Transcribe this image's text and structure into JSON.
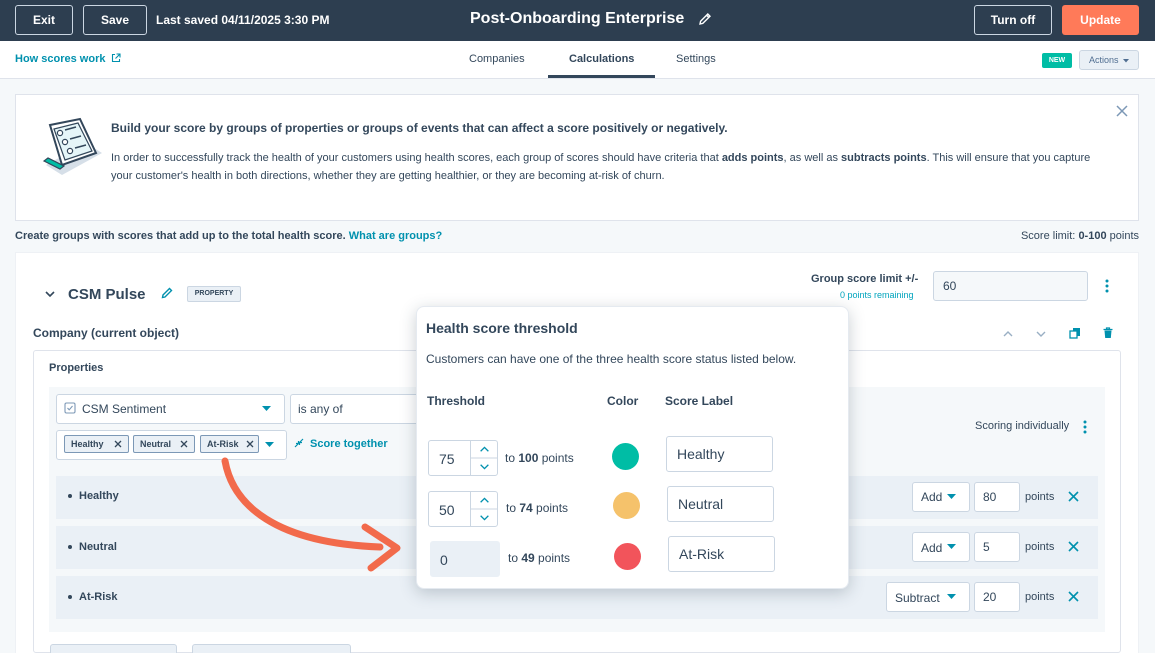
{
  "topbar": {
    "exit_label": "Exit",
    "save_label": "Save",
    "last_saved": "Last saved 04/11/2025 3:30 PM",
    "title": "Post-Onboarding Enterprise",
    "turn_off_label": "Turn off",
    "update_label": "Update"
  },
  "subnav": {
    "how_scores_work": "How scores work",
    "tabs": [
      {
        "label": "Companies"
      },
      {
        "label": "Calculations"
      },
      {
        "label": "Settings"
      }
    ],
    "new_badge": "NEW",
    "actions_label": "Actions"
  },
  "banner": {
    "title": "Build your score by groups of properties or groups of events that can affect a score positively or negatively.",
    "body_part1": "In order to successfully track the health of your customers using health scores, each group of scores should have criteria that ",
    "body_bold1": "adds points",
    "body_part2": ", as well as ",
    "body_bold2": "subtracts points",
    "body_part3": ". This will ensure that you capture your customer's health in both directions, whether they are getting healthier, or they are becoming at-risk of churn."
  },
  "groups": {
    "text": "Create groups with scores that add up to the total health score.",
    "link": "What are groups?",
    "score_limit_label": "Score limit:",
    "score_limit_value": "0-100",
    "score_limit_unit": "points"
  },
  "group": {
    "title": "CSM Pulse",
    "badge": "PROPERTY",
    "limit_label": "Group score limit +/-",
    "remaining": "0 points remaining",
    "limit_value": "60",
    "object_label": "Company (current object)",
    "properties_label": "Properties",
    "property_select": "CSM Sentiment",
    "operator_select": "is any of",
    "tags": [
      "Healthy",
      "Neutral",
      "At-Risk"
    ],
    "score_together": "Score together",
    "scoring_individually": "Scoring individually",
    "rows": [
      {
        "label": "Healthy",
        "op": "Add",
        "points": "80",
        "unit": "points"
      },
      {
        "label": "Neutral",
        "op": "Add",
        "points": "5",
        "unit": "points"
      },
      {
        "label": "At-Risk",
        "op": "Subtract",
        "points": "20",
        "unit": "points"
      }
    ]
  },
  "popup": {
    "title": "Health score threshold",
    "desc": "Customers can have one of the three health score status listed below.",
    "col_threshold": "Threshold",
    "col_color": "Color",
    "col_label": "Score Label",
    "rows": [
      {
        "value": "75",
        "to_prefix": "to ",
        "to_value": "100",
        "to_suffix": " points",
        "color": "#00bda5",
        "label": "Healthy"
      },
      {
        "value": "50",
        "to_prefix": "to ",
        "to_value": "74",
        "to_suffix": " points",
        "color": "#f5c26b",
        "label": "Neutral"
      },
      {
        "value": "0",
        "to_prefix": "to ",
        "to_value": "49",
        "to_suffix": " points",
        "color": "#f2545b",
        "label": "At-Risk"
      }
    ]
  },
  "colors": {
    "topbar_bg": "#2d3e50",
    "accent_orange": "#ff7a59",
    "link_teal": "#0091ae",
    "arrow_orange": "#f26a4b"
  }
}
